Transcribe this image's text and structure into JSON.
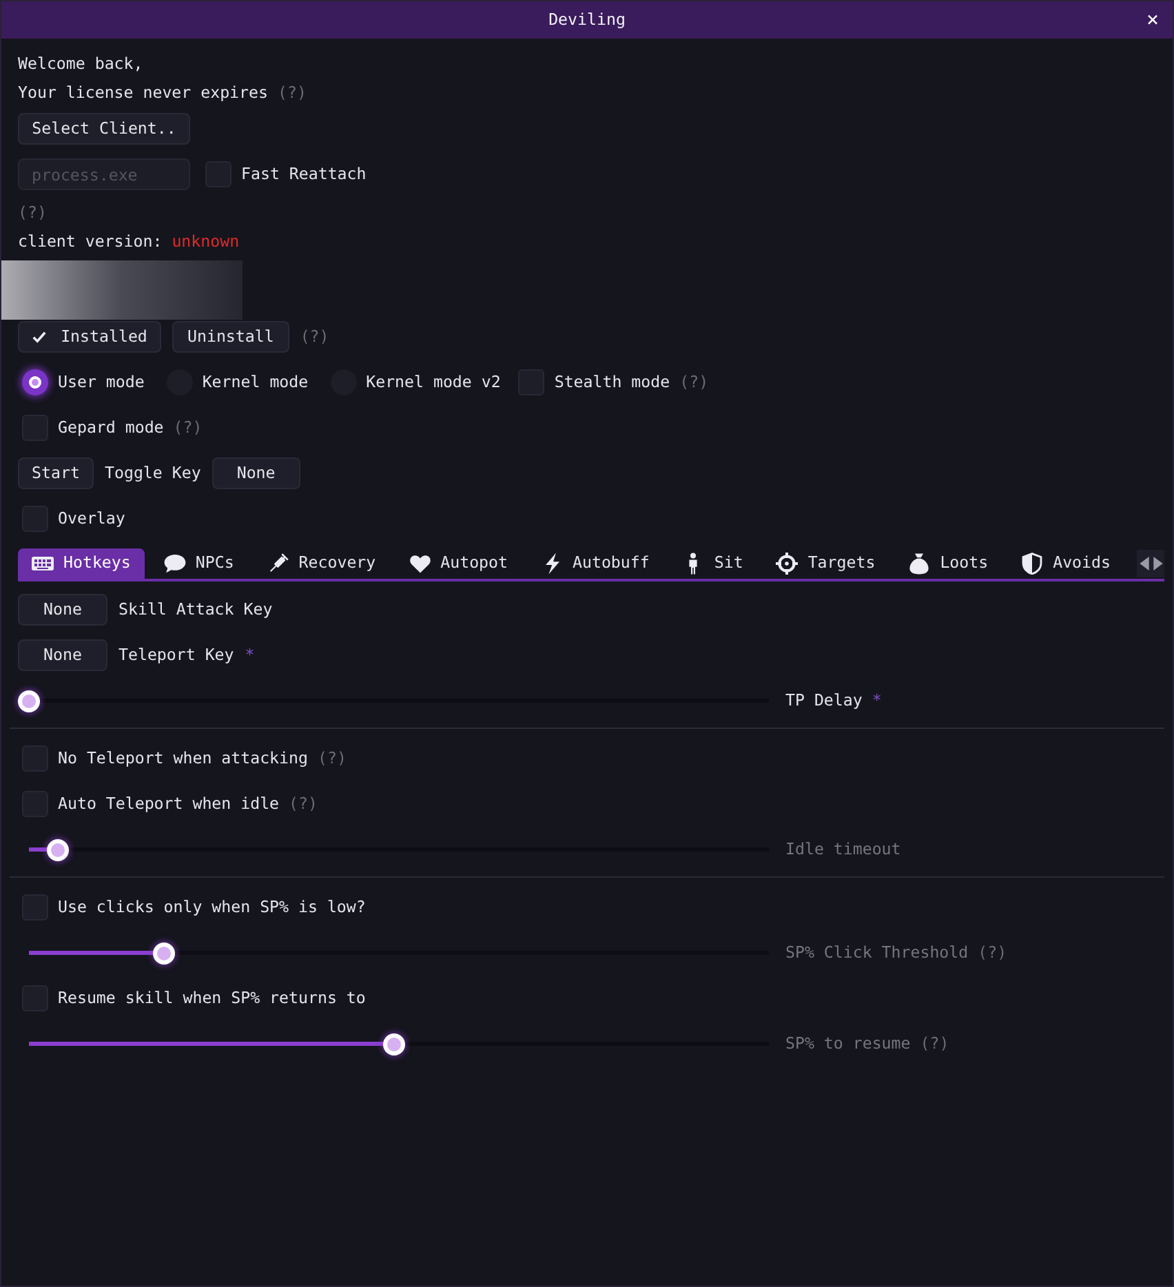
{
  "window": {
    "title": "Deviling",
    "close": "×"
  },
  "account": {
    "greeting": "Welcome back,",
    "license": "Your license never expires",
    "license_help": "(?)"
  },
  "client": {
    "select_button": "Select Client..",
    "process_field": {
      "placeholder": "process.exe"
    },
    "fast_reattach": {
      "label": "Fast Reattach",
      "checked": false
    },
    "help": "(?)",
    "version_label": "client version:",
    "version_value": "unknown"
  },
  "install": {
    "installed_button": {
      "label": "Installed",
      "checked": true
    },
    "uninstall_button": "Uninstall",
    "help": "(?)"
  },
  "modes": [
    {
      "label": "User mode",
      "selected": true
    },
    {
      "label": "Kernel mode",
      "selected": false
    },
    {
      "label": "Kernel mode v2",
      "selected": false
    }
  ],
  "stealth_mode": {
    "label": "Stealth mode",
    "checked": false,
    "help": "(?)"
  },
  "gepard_mode": {
    "label": "Gepard mode",
    "checked": false,
    "help": "(?)"
  },
  "start_button": "Start",
  "toggle_key": {
    "label": "Toggle Key",
    "value": "None"
  },
  "overlay": {
    "label": "Overlay",
    "checked": false
  },
  "tabs": [
    {
      "label": "Hotkeys",
      "selected": true
    },
    {
      "label": "NPCs",
      "selected": false
    },
    {
      "label": "Recovery",
      "selected": false
    },
    {
      "label": "Autopot",
      "selected": false
    },
    {
      "label": "Autobuff",
      "selected": false
    },
    {
      "label": "Sit",
      "selected": false
    },
    {
      "label": "Targets",
      "selected": false
    },
    {
      "label": "Loots",
      "selected": false
    },
    {
      "label": "Avoids",
      "selected": false
    }
  ],
  "hotkeys": {
    "groups": [
      {
        "items": [
          {
            "kind": "key",
            "value": "None",
            "label": "Skill Attack Key"
          },
          {
            "kind": "key",
            "value": "None",
            "label": "Teleport Key",
            "marker": "*"
          },
          {
            "kind": "slider",
            "label": "TP Delay",
            "marker": "*",
            "level": 0,
            "disabled": false
          }
        ]
      },
      {
        "items": [
          {
            "kind": "checkbox",
            "label": "No Teleport when attacking",
            "help": "(?)",
            "checked": false
          },
          {
            "kind": "checkbox",
            "label": "Auto Teleport when idle",
            "help": "(?)",
            "checked": false
          },
          {
            "kind": "slider",
            "label": "Idle timeout",
            "level": 0.04,
            "disabled": true
          }
        ]
      },
      {
        "items": [
          {
            "kind": "checkbox",
            "label": "Use clicks only when SP% is low?",
            "checked": false
          },
          {
            "kind": "slider",
            "label": "SP% Click Threshold",
            "help": "(?)",
            "level": 0.185,
            "disabled": true
          },
          {
            "kind": "checkbox",
            "label": "Resume skill when SP% returns to",
            "checked": false
          },
          {
            "kind": "slider",
            "label": "SP% to resume",
            "help": "(?)",
            "level": 0.5,
            "disabled": true
          }
        ]
      }
    ]
  }
}
